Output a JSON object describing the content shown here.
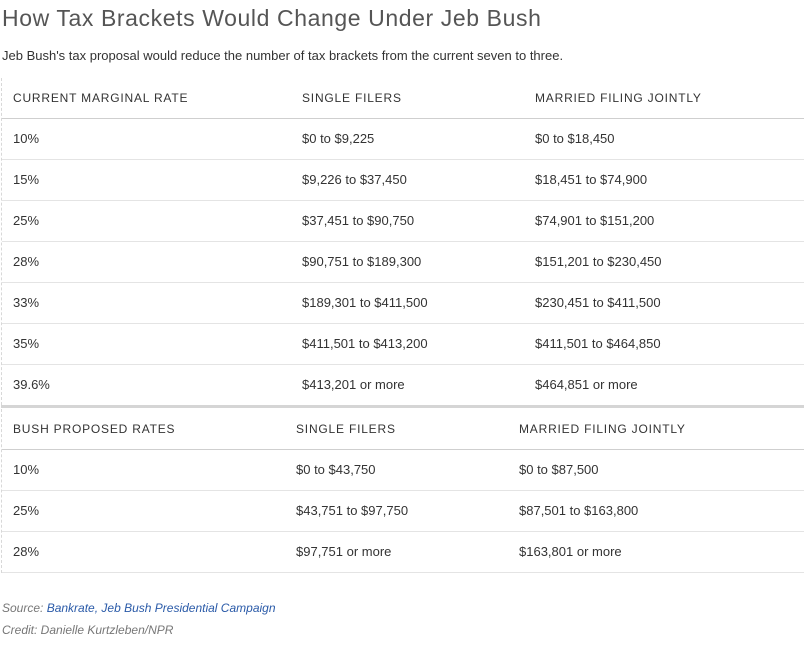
{
  "title": "How Tax Brackets Would Change Under Jeb Bush",
  "subtitle": "Jeb Bush's tax proposal would reduce the number of tax brackets from the current seven to three.",
  "current": {
    "headers": [
      "CURRENT MARGINAL RATE",
      "SINGLE FILERS",
      "MARRIED FILING JOINTLY"
    ],
    "rows": [
      [
        "10%",
        "$0 to $9,225",
        "$0 to $18,450"
      ],
      [
        "15%",
        "$9,226 to $37,450",
        "$18,451 to $74,900"
      ],
      [
        "25%",
        "$37,451 to $90,750",
        "$74,901 to $151,200"
      ],
      [
        "28%",
        "$90,751 to $189,300",
        "$151,201 to $230,450"
      ],
      [
        "33%",
        "$189,301 to $411,500",
        "$230,451 to $411,500"
      ],
      [
        "35%",
        "$411,501 to $413,200",
        "$411,501 to $464,850"
      ],
      [
        "39.6%",
        "$413,201 or more",
        "$464,851 or more"
      ]
    ]
  },
  "proposed": {
    "headers": [
      "BUSH PROPOSED RATES",
      "SINGLE FILERS",
      "MARRIED FILING JOINTLY"
    ],
    "rows": [
      [
        "10%",
        "$0 to $43,750",
        "$0 to $87,500"
      ],
      [
        "25%",
        "$43,751 to $97,750",
        "$87,501 to $163,800"
      ],
      [
        "28%",
        "$97,751 or more",
        "$163,801 or more"
      ]
    ]
  },
  "source": {
    "label": "Source:",
    "link_text": "Bankrate, Jeb Bush Presidential Campaign"
  },
  "credit": "Credit: Danielle Kurtzleben/NPR",
  "colors": {
    "link": "#2a5aa8",
    "title": "#555555",
    "divider": "#d5d5d5"
  }
}
